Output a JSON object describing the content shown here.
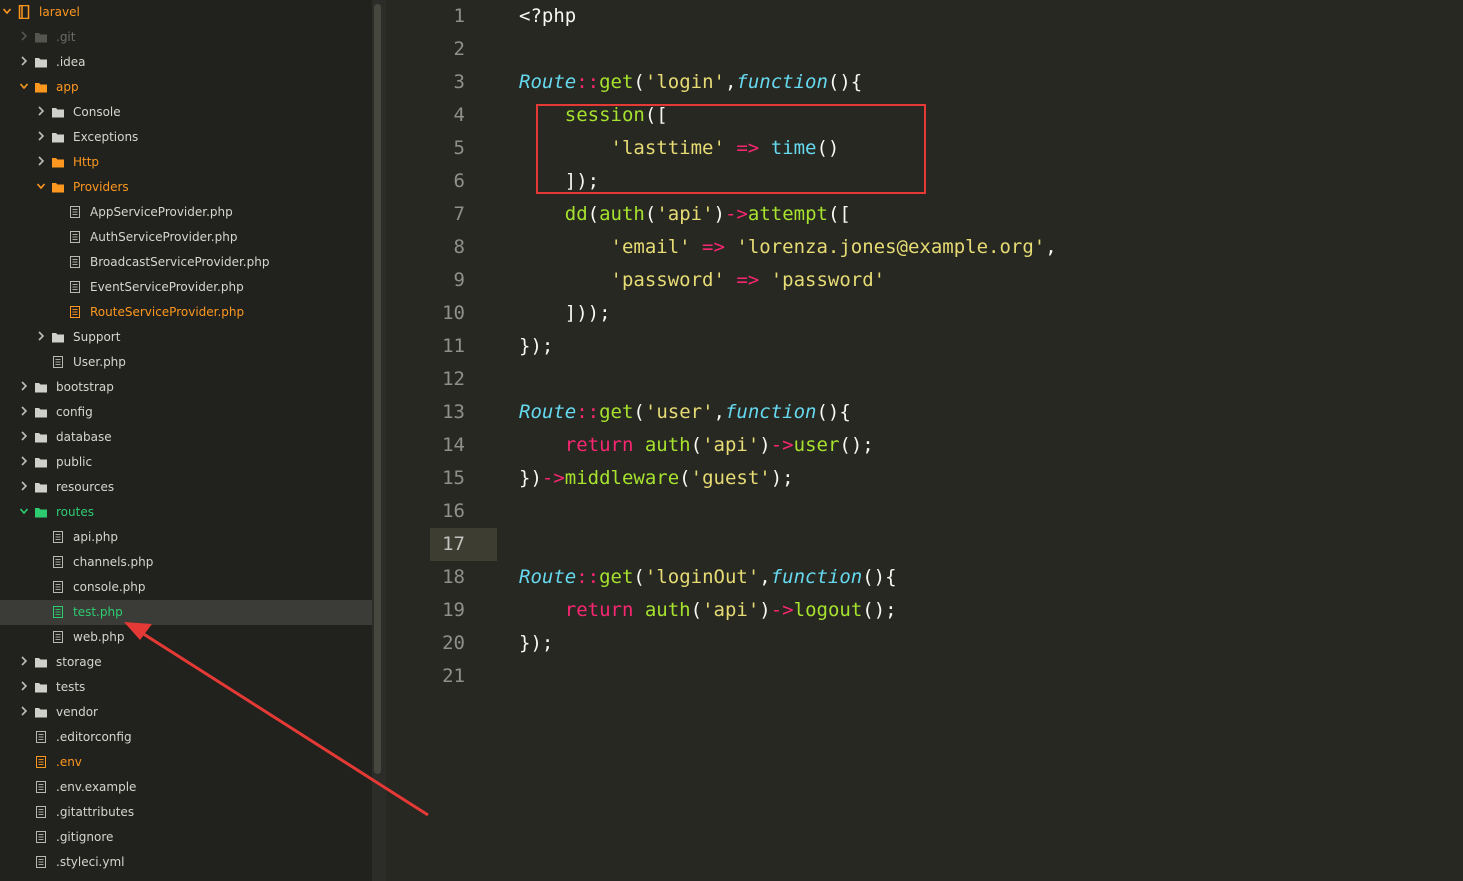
{
  "sidebar": {
    "items": [
      {
        "label": "laravel",
        "depth": 0,
        "kind": "project",
        "expanded": true,
        "color": "#fd971f"
      },
      {
        "label": ".git",
        "depth": 1,
        "kind": "folder",
        "expanded": false,
        "color": "#6b6b66",
        "dim": true
      },
      {
        "label": ".idea",
        "depth": 1,
        "kind": "folder",
        "expanded": false,
        "color": "#d6d6d0"
      },
      {
        "label": "app",
        "depth": 1,
        "kind": "folder",
        "expanded": true,
        "color": "#fd971f"
      },
      {
        "label": "Console",
        "depth": 2,
        "kind": "folder",
        "expanded": false,
        "color": "#d6d6d0"
      },
      {
        "label": "Exceptions",
        "depth": 2,
        "kind": "folder",
        "expanded": false,
        "color": "#d6d6d0"
      },
      {
        "label": "Http",
        "depth": 2,
        "kind": "folder",
        "expanded": false,
        "color": "#fd971f"
      },
      {
        "label": "Providers",
        "depth": 2,
        "kind": "folder",
        "expanded": true,
        "color": "#fd971f"
      },
      {
        "label": "AppServiceProvider.php",
        "depth": 3,
        "kind": "file",
        "color": "#d6d6d0"
      },
      {
        "label": "AuthServiceProvider.php",
        "depth": 3,
        "kind": "file",
        "color": "#d6d6d0"
      },
      {
        "label": "BroadcastServiceProvider.php",
        "depth": 3,
        "kind": "file",
        "color": "#d6d6d0"
      },
      {
        "label": "EventServiceProvider.php",
        "depth": 3,
        "kind": "file",
        "color": "#d6d6d0"
      },
      {
        "label": "RouteServiceProvider.php",
        "depth": 3,
        "kind": "file",
        "color": "#fd971f"
      },
      {
        "label": "Support",
        "depth": 2,
        "kind": "folder",
        "expanded": false,
        "color": "#d6d6d0"
      },
      {
        "label": "User.php",
        "depth": 2,
        "kind": "file",
        "color": "#d6d6d0"
      },
      {
        "label": "bootstrap",
        "depth": 1,
        "kind": "folder",
        "expanded": false,
        "color": "#d6d6d0"
      },
      {
        "label": "config",
        "depth": 1,
        "kind": "folder",
        "expanded": false,
        "color": "#d6d6d0"
      },
      {
        "label": "database",
        "depth": 1,
        "kind": "folder",
        "expanded": false,
        "color": "#d6d6d0"
      },
      {
        "label": "public",
        "depth": 1,
        "kind": "folder",
        "expanded": false,
        "color": "#d6d6d0"
      },
      {
        "label": "resources",
        "depth": 1,
        "kind": "folder",
        "expanded": false,
        "color": "#d6d6d0"
      },
      {
        "label": "routes",
        "depth": 1,
        "kind": "folder",
        "expanded": true,
        "color": "#2ecc71"
      },
      {
        "label": "api.php",
        "depth": 2,
        "kind": "file",
        "color": "#d6d6d0"
      },
      {
        "label": "channels.php",
        "depth": 2,
        "kind": "file",
        "color": "#d6d6d0"
      },
      {
        "label": "console.php",
        "depth": 2,
        "kind": "file",
        "color": "#d6d6d0"
      },
      {
        "label": "test.php",
        "depth": 2,
        "kind": "file",
        "color": "#2ecc71",
        "selected": true
      },
      {
        "label": "web.php",
        "depth": 2,
        "kind": "file",
        "color": "#d6d6d0"
      },
      {
        "label": "storage",
        "depth": 1,
        "kind": "folder",
        "expanded": false,
        "color": "#d6d6d0"
      },
      {
        "label": "tests",
        "depth": 1,
        "kind": "folder",
        "expanded": false,
        "color": "#d6d6d0"
      },
      {
        "label": "vendor",
        "depth": 1,
        "kind": "folder",
        "expanded": false,
        "color": "#d6d6d0"
      },
      {
        "label": ".editorconfig",
        "depth": 1,
        "kind": "file",
        "color": "#d6d6d0"
      },
      {
        "label": ".env",
        "depth": 1,
        "kind": "file",
        "color": "#fd971f"
      },
      {
        "label": ".env.example",
        "depth": 1,
        "kind": "file",
        "color": "#d6d6d0"
      },
      {
        "label": ".gitattributes",
        "depth": 1,
        "kind": "file",
        "color": "#d6d6d0"
      },
      {
        "label": ".gitignore",
        "depth": 1,
        "kind": "file",
        "color": "#d6d6d0"
      },
      {
        "label": ".styleci.yml",
        "depth": 1,
        "kind": "file",
        "color": "#d6d6d0"
      }
    ]
  },
  "editor": {
    "current_line": 17,
    "lines": [
      [
        [
          "<?php",
          "p"
        ]
      ],
      [],
      [
        [
          "Route",
          "cls"
        ],
        [
          "::",
          "kw"
        ],
        [
          "get",
          "fn"
        ],
        [
          "(",
          "p"
        ],
        [
          "'login'",
          "str"
        ],
        [
          ",",
          "p"
        ],
        [
          "function",
          "sup"
        ],
        [
          "(){",
          "p"
        ]
      ],
      [
        [
          "    ",
          "p"
        ],
        [
          "session",
          "fn"
        ],
        [
          "([",
          "p"
        ]
      ],
      [
        [
          "        ",
          "p"
        ],
        [
          "'lasttime'",
          "str"
        ],
        [
          " ",
          "p"
        ],
        [
          "=>",
          "kw"
        ],
        [
          " ",
          "p"
        ],
        [
          "time",
          "bi"
        ],
        [
          "()",
          "p"
        ]
      ],
      [
        [
          "    ",
          "p"
        ],
        [
          "]);",
          "p"
        ]
      ],
      [
        [
          "    ",
          "p"
        ],
        [
          "dd",
          "fn"
        ],
        [
          "(",
          "p"
        ],
        [
          "auth",
          "fn"
        ],
        [
          "(",
          "p"
        ],
        [
          "'api'",
          "str"
        ],
        [
          ")",
          "p"
        ],
        [
          "->",
          "kw"
        ],
        [
          "attempt",
          "fn"
        ],
        [
          "([",
          "p"
        ]
      ],
      [
        [
          "        ",
          "p"
        ],
        [
          "'email'",
          "str"
        ],
        [
          " ",
          "p"
        ],
        [
          "=>",
          "kw"
        ],
        [
          " ",
          "p"
        ],
        [
          "'lorenza.jones@example.org'",
          "str"
        ],
        [
          ",",
          "p"
        ]
      ],
      [
        [
          "        ",
          "p"
        ],
        [
          "'password'",
          "str"
        ],
        [
          " ",
          "p"
        ],
        [
          "=>",
          "kw"
        ],
        [
          " ",
          "p"
        ],
        [
          "'password'",
          "str"
        ]
      ],
      [
        [
          "    ",
          "p"
        ],
        [
          "]));",
          "p"
        ]
      ],
      [
        [
          "});",
          "p"
        ]
      ],
      [],
      [
        [
          "Route",
          "cls"
        ],
        [
          "::",
          "kw"
        ],
        [
          "get",
          "fn"
        ],
        [
          "(",
          "p"
        ],
        [
          "'user'",
          "str"
        ],
        [
          ",",
          "p"
        ],
        [
          "function",
          "sup"
        ],
        [
          "(){",
          "p"
        ]
      ],
      [
        [
          "    ",
          "p"
        ],
        [
          "return",
          "kw"
        ],
        [
          " ",
          "p"
        ],
        [
          "auth",
          "fn"
        ],
        [
          "(",
          "p"
        ],
        [
          "'api'",
          "str"
        ],
        [
          ")",
          "p"
        ],
        [
          "->",
          "kw"
        ],
        [
          "user",
          "fn"
        ],
        [
          "();",
          "p"
        ]
      ],
      [
        [
          "})",
          "p"
        ],
        [
          "->",
          "kw"
        ],
        [
          "middleware",
          "fn"
        ],
        [
          "(",
          "p"
        ],
        [
          "'guest'",
          "str"
        ],
        [
          ");",
          "p"
        ]
      ],
      [],
      [],
      [
        [
          "Route",
          "cls"
        ],
        [
          "::",
          "kw"
        ],
        [
          "get",
          "fn"
        ],
        [
          "(",
          "p"
        ],
        [
          "'loginOut'",
          "str"
        ],
        [
          ",",
          "p"
        ],
        [
          "function",
          "sup"
        ],
        [
          "(){",
          "p"
        ]
      ],
      [
        [
          "    ",
          "p"
        ],
        [
          "return",
          "kw"
        ],
        [
          " ",
          "p"
        ],
        [
          "auth",
          "fn"
        ],
        [
          "(",
          "p"
        ],
        [
          "'api'",
          "str"
        ],
        [
          ")",
          "p"
        ],
        [
          "->",
          "kw"
        ],
        [
          "logout",
          "fn"
        ],
        [
          "();",
          "p"
        ]
      ],
      [
        [
          "});",
          "p"
        ]
      ],
      []
    ]
  },
  "annotations": {
    "highlight_color": "#e53935",
    "highlight_lines": [
      4,
      6
    ],
    "arrow_target": "test.php"
  }
}
